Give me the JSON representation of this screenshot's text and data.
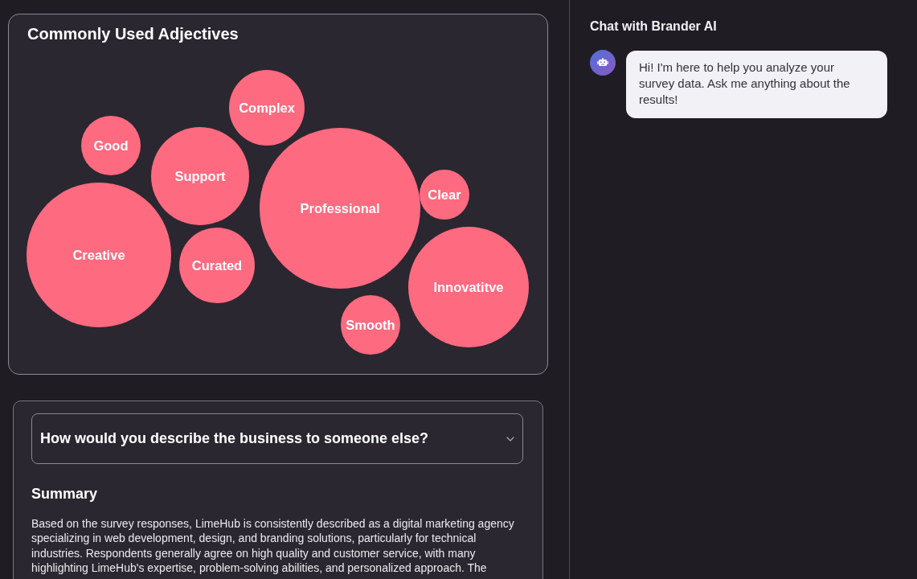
{
  "adjectives_card": {
    "title": "Commonly Used Adjectives",
    "words": [
      "Complex",
      "Good",
      "Support",
      "Clear",
      "Professional",
      "Creative",
      "Curated",
      "Innovatitve",
      "Smooth"
    ]
  },
  "question_card": {
    "question_dropdown": {
      "value": "How would you describe the business to someone else?",
      "expanded": false
    },
    "summary": {
      "heading": "Summary",
      "text": "Based on the survey responses, LimeHub is consistently described as a digital marketing agency specializing in web development, design, and branding solutions, particularly for technical industries. Respondents generally agree on high quality and customer service, with many highlighting LimeHub's expertise, problem-solving abilities, and personalized approach. The"
    }
  },
  "chat": {
    "title": "Chat with Brander AI",
    "messages": [
      {
        "kind": "bot",
        "text": "Hi! I'm here to help you analyze your survey data. Ask me anything about the results!"
      }
    ]
  }
}
